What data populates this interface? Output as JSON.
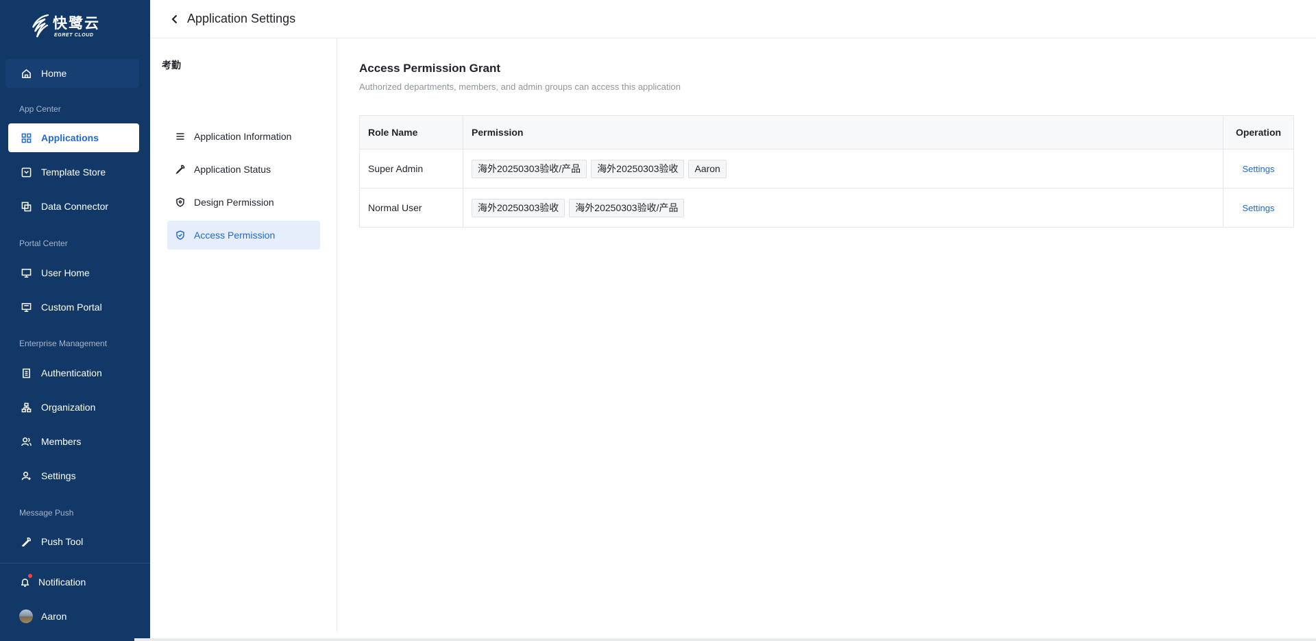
{
  "brand": {
    "name_cn": "快鹭云",
    "name_en": "EGRET CLOUD"
  },
  "sidebar": {
    "home": "Home",
    "sections": {
      "app_center": "App Center",
      "portal_center": "Portal Center",
      "enterprise": "Enterprise Management",
      "message": "Message Push"
    },
    "items": {
      "applications": "Applications",
      "template_store": "Template Store",
      "data_connector": "Data Connector",
      "user_home": "User Home",
      "custom_portal": "Custom Portal",
      "authentication": "Authentication",
      "organization": "Organization",
      "members": "Members",
      "settings": "Settings",
      "push_tool": "Push Tool"
    },
    "notification": "Notification",
    "user": "Aaron",
    "active_item": "applications"
  },
  "header": {
    "title": "Application Settings"
  },
  "settings_menu": {
    "app_name": "考勤",
    "items": [
      {
        "label": "Application Information",
        "icon": "list-icon"
      },
      {
        "label": "Application Status",
        "icon": "wrench-icon"
      },
      {
        "label": "Design Permission",
        "icon": "shield-icon"
      },
      {
        "label": "Access Permission",
        "icon": "shield-check-icon"
      }
    ],
    "active_index": 3
  },
  "main": {
    "title": "Access Permission Grant",
    "subtitle": "Authorized departments, members, and admin groups can access this application",
    "table": {
      "headers": {
        "role": "Role Name",
        "permission": "Permission",
        "operation": "Operation"
      },
      "rows": [
        {
          "role": "Super Admin",
          "permissions": [
            "海外20250303验收/产品",
            "海外20250303验收",
            "Aaron"
          ],
          "action": "Settings"
        },
        {
          "role": "Normal User",
          "permissions": [
            "海外20250303验收",
            "海外20250303验收/产品"
          ],
          "action": "Settings"
        }
      ]
    }
  },
  "colors": {
    "sidebar_bg": "#113866",
    "accent": "#1d68d6",
    "active_menu_bg": "#e6eefb",
    "notification_dot": "#f04848"
  }
}
